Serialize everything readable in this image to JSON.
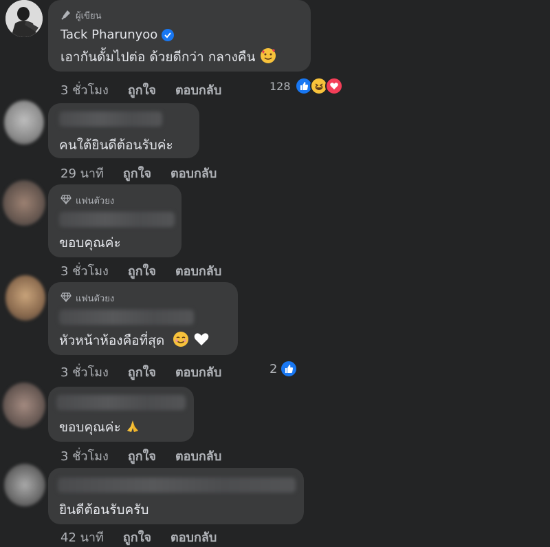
{
  "comments": [
    {
      "badge": "ผู้เขียน",
      "author": "Tack Pharunyoo",
      "text": "เอากันดั้มไปต่อ ด้วยดีกว่า กลางคืน",
      "time": "3 ชั่วโมง",
      "like_label": "ถูกใจ",
      "reply_label": "ตอบกลับ",
      "reaction_count": "128",
      "reactions": [
        "like-icon",
        "laugh-icon",
        "love-icon"
      ]
    },
    {
      "text": "คนใต้ยินดีต้อนรับค่ะ",
      "time": "29 นาที",
      "like_label": "ถูกใจ",
      "reply_label": "ตอบกลับ"
    },
    {
      "badge": "แฟนตัวยง",
      "text": "ขอบคุณค่ะ",
      "time": "3 ชั่วโมง",
      "like_label": "ถูกใจ",
      "reply_label": "ตอบกลับ"
    },
    {
      "badge": "แฟนตัวยง",
      "text": "หัวหน้าห้องคือที่สุด",
      "time": "3 ชั่วโมง",
      "like_label": "ถูกใจ",
      "reply_label": "ตอบกลับ",
      "reaction_count": "2",
      "reactions": [
        "like-icon"
      ]
    },
    {
      "text": "ขอบคุณค่ะ",
      "time": "3 ชั่วโมง",
      "like_label": "ถูกใจ",
      "reply_label": "ตอบกลับ"
    },
    {
      "text": "ยินดีต้อนรับครับ",
      "time": "42 นาที",
      "like_label": "ถูกใจ",
      "reply_label": "ตอบกลับ"
    }
  ],
  "colors": {
    "background": "#232425",
    "bubble": "#3a3b3c",
    "like_blue": "#1877f2",
    "love_red": "#f33e58"
  }
}
